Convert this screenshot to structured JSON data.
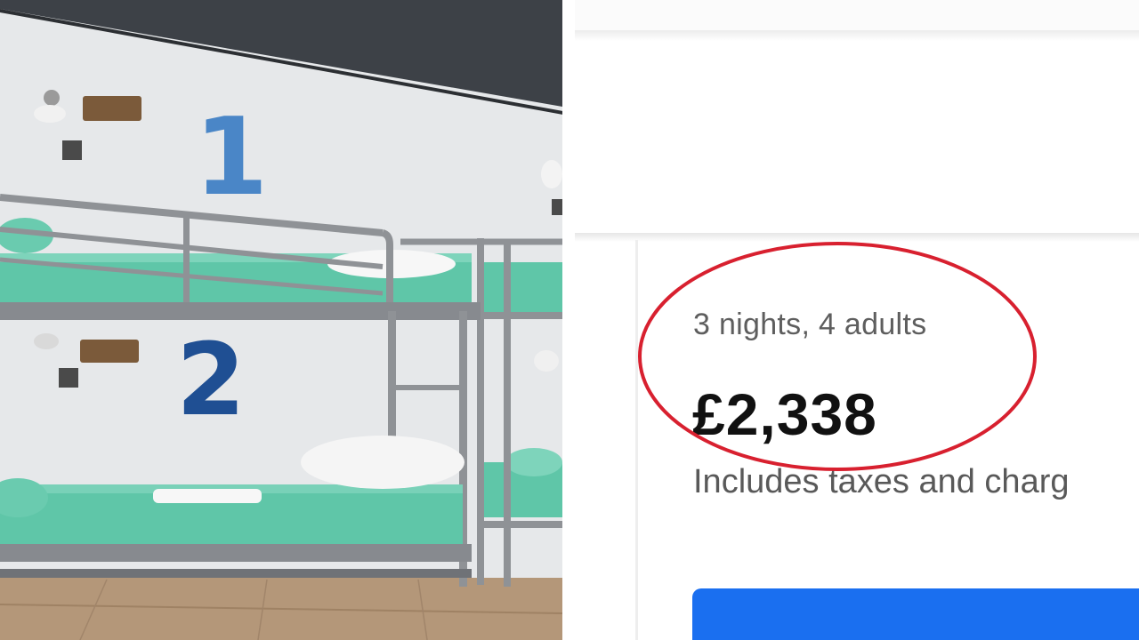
{
  "photo": {
    "bunk_numbers": [
      "1",
      "2"
    ]
  },
  "listing": {
    "stay_summary": "3 nights, 4 adults",
    "total_price": "£2,338",
    "price_note": "Includes taxes and charg"
  },
  "colors": {
    "highlight_ring": "#d8202f",
    "cta_button": "#1a6ff0",
    "bedding": "#5fc6a8",
    "bunk_frame": "#8f9296",
    "wall": "#e6e8ea",
    "floor": "#b49779"
  }
}
